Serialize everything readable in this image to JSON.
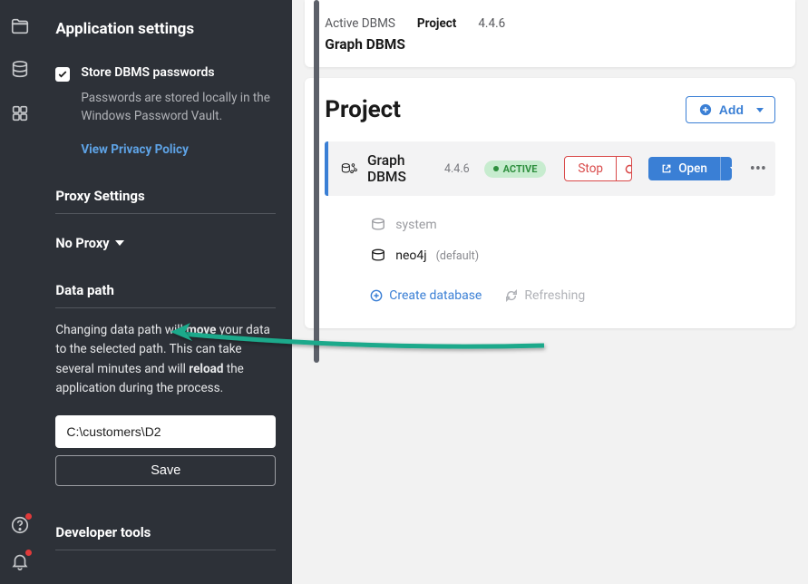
{
  "settings": {
    "title": "Application settings",
    "store_passwords_label": "Store DBMS passwords",
    "store_passwords_sub": "Passwords are stored locally in the Windows Password Vault.",
    "privacy_link": "View Privacy Policy",
    "proxy_heading": "Proxy Settings",
    "proxy_value": "No Proxy",
    "data_path_heading": "Data path",
    "data_path_warning_pre": "Changing data path will ",
    "data_path_warning_b1": "move",
    "data_path_warning_mid": " your data to the selected path. This can take several minutes and will ",
    "data_path_warning_b2": "reload",
    "data_path_warning_post": " the application during the process.",
    "data_path_value": "C:\\customers\\D2",
    "save_label": "Save",
    "dev_tools_heading": "Developer tools"
  },
  "header": {
    "breadcrumb_active": "Active DBMS",
    "breadcrumb_project": "Project",
    "breadcrumb_version": "4.4.6",
    "dbms_title": "Graph DBMS"
  },
  "project": {
    "title": "Project",
    "add_label": "Add",
    "dbms_row": {
      "name": "Graph DBMS",
      "version": "4.4.6",
      "status": "ACTIVE",
      "stop_label": "Stop",
      "open_label": "Open"
    },
    "databases": [
      {
        "name": "system",
        "muted": true
      },
      {
        "name": "neo4j",
        "default_label": "(default)"
      }
    ],
    "create_label": "Create database",
    "refresh_label": "Refreshing"
  }
}
